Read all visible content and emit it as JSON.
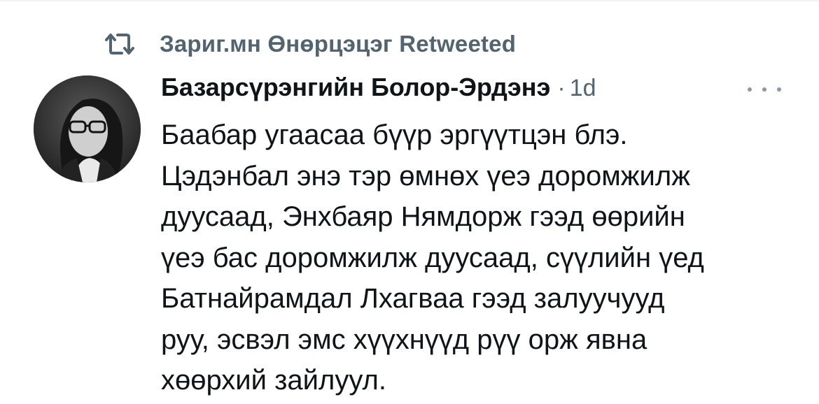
{
  "retweet": {
    "icon": "retweet-icon",
    "text": "Зариг.мн Өнөрцэцэг Retweeted"
  },
  "tweet": {
    "author": "Базарсүрэнгийн Болор-Эрдэнэ",
    "separator": "·",
    "timestamp": "1d",
    "more_icon": "more-horizontal-icon",
    "avatar_icon": "profile-avatar",
    "text_lines": [
      "Баабар угаасаа бүүр эргүүтцэн блэ.",
      "Цэдэнбал энэ тэр өмнөх үеэ доромжилж",
      "дуусаад, Энхбаяр Нямдорж гээд өөрийн",
      "үеэ бас доромжилж дуусаад, сүүлийн үед",
      "Батнайрамдал Лхагваа гээд залуучууд",
      "руу, эсвэл эмс хүүхнүүд рүү орж явна",
      "хөөрхий зайлуул."
    ]
  },
  "colors": {
    "primary_text": "#0f1419",
    "secondary_text": "#536471",
    "divider": "#eff3f4"
  }
}
